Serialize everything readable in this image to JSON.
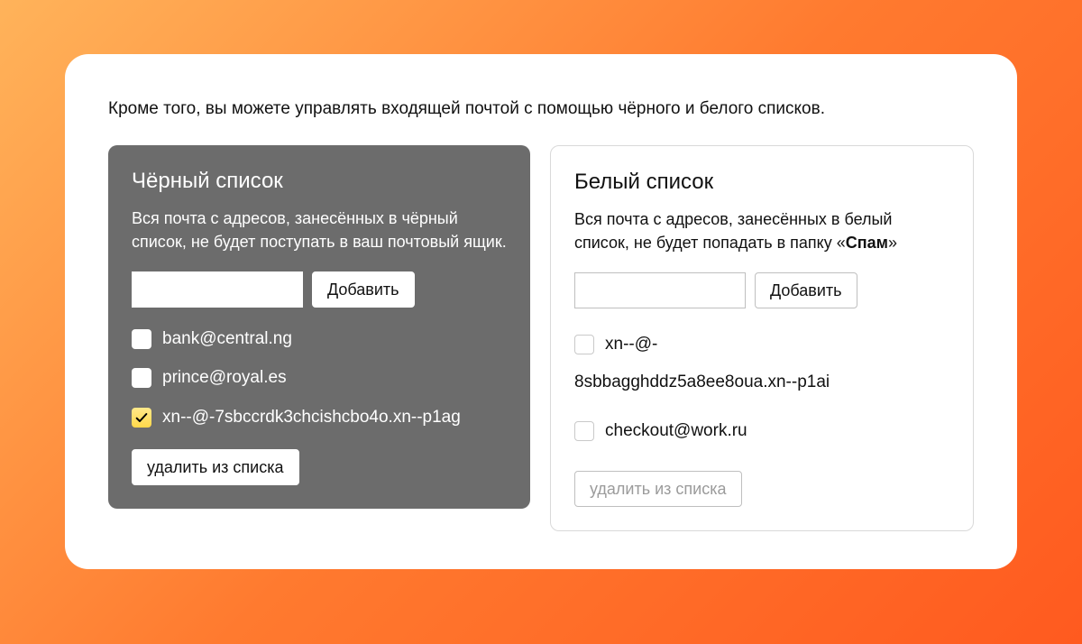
{
  "intro": "Кроме того, вы можете управлять входящей почтой с помощью чёрного и белого списков.",
  "blacklist": {
    "title": "Чёрный список",
    "desc": "Вся почта с адресов, занесённых в чёрный список, не будет поступать в ваш почтовый ящик.",
    "add_label": "Добавить",
    "input_value": "",
    "items": [
      {
        "email": "bank@central.ng",
        "checked": false
      },
      {
        "email": "prince@royal.es",
        "checked": false
      },
      {
        "email": "xn--@-7sbccrdk3chcishcbo4o.xn--p1ag",
        "checked": true
      }
    ],
    "remove_label": "удалить из списка"
  },
  "whitelist": {
    "title": "Белый список",
    "desc_prefix": "Вся почта с адресов, занесённых в белый список, не будет попадать в папку «",
    "desc_bold": "Спам",
    "desc_suffix": "»",
    "add_label": "Добавить",
    "input_value": "",
    "items": [
      {
        "line1": "xn--@-",
        "line2": "8sbbagghddz5a8ee8oua.xn--p1ai",
        "checked": false
      },
      {
        "line1": "checkout@work.ru",
        "line2": "",
        "checked": false
      }
    ],
    "remove_label": "удалить из списка"
  }
}
